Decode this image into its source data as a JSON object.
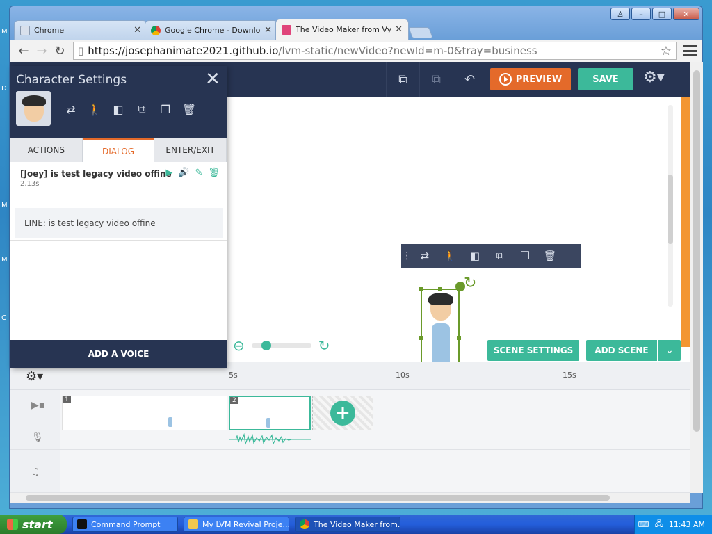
{
  "desktop": {
    "edge_letters": [
      "M",
      "D",
      "M",
      "M",
      "C"
    ]
  },
  "browser": {
    "tabs": [
      {
        "title": "Chrome",
        "icon": "page-icon",
        "active": false
      },
      {
        "title": "Google Chrome - Download t",
        "icon": "chrome-icon",
        "active": false
      },
      {
        "title": "The Video Maker from Vy",
        "icon": "vyond-icon",
        "active": true
      }
    ],
    "url_host": "https://josephanimate2021.github.io",
    "url_path": "/lvm-static/newVideo?newId=m-0&tray=business"
  },
  "app": {
    "preview_label": "PREVIEW",
    "save_label": "SAVE",
    "scene_settings_label": "SCENE SETTINGS",
    "add_scene_label": "ADD SCENE"
  },
  "panel": {
    "title": "Character Settings",
    "tabs": [
      "ACTIONS",
      "DIALOG",
      "ENTER/EXIT"
    ],
    "active_tab": "DIALOG",
    "dialog": {
      "title": "[Joey] is test legacy video offine",
      "duration": "2.13s",
      "line": "LINE: is test legacy video offine"
    },
    "footer_label": "ADD A VOICE"
  },
  "timeline": {
    "ticks": [
      "5s",
      "10s",
      "15s"
    ],
    "scenes": [
      "1",
      "2"
    ],
    "selected_scene": "2"
  },
  "taskbar": {
    "start_label": "start",
    "tasks": [
      {
        "label": "Command Prompt",
        "active": false
      },
      {
        "label": "My LVM Revival Proje...",
        "active": false
      },
      {
        "label": "The Video Maker from...",
        "active": true
      }
    ],
    "clock": "11:43 AM"
  },
  "colors": {
    "accent_green": "#3cb99a",
    "accent_orange": "#e46a2a",
    "navy": "#273452"
  }
}
